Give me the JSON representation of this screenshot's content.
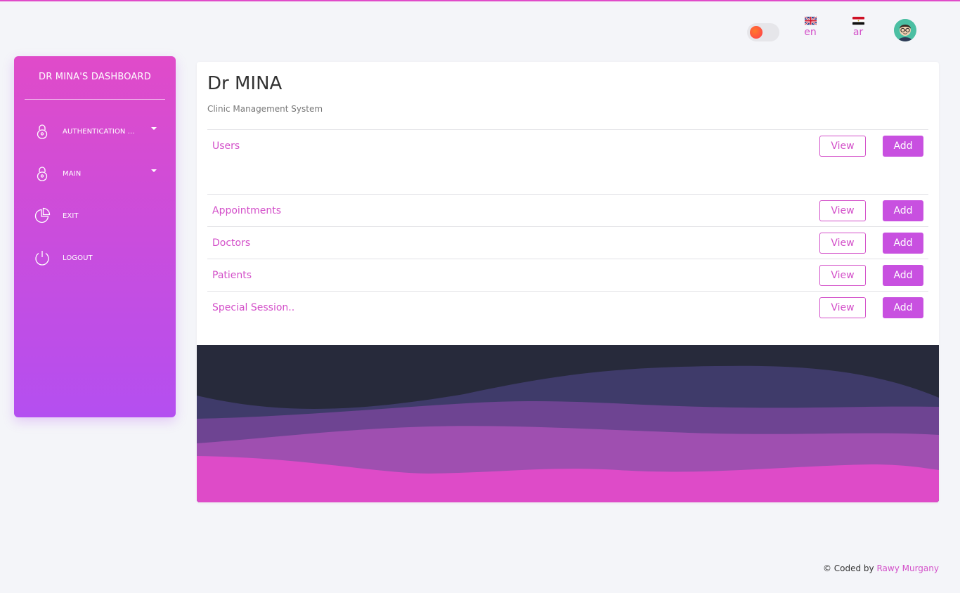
{
  "header": {
    "languages": [
      {
        "code": "en",
        "flag_icon": "uk-flag-icon"
      },
      {
        "code": "ar",
        "flag_icon": "egypt-flag-icon"
      }
    ],
    "theme_toggle_icon": "theme-toggle-icon",
    "avatar_icon": "user-avatar-icon"
  },
  "sidebar": {
    "title": "DR MINA'S DASHBOARD",
    "items": [
      {
        "label": "AUTHENTICATION ...",
        "icon": "lock-icon",
        "has_dropdown": true
      },
      {
        "label": "MAIN",
        "icon": "lock-icon",
        "has_dropdown": true
      },
      {
        "label": "EXIT",
        "icon": "pie-chart-icon",
        "has_dropdown": false
      },
      {
        "label": "LOGOUT",
        "icon": "power-icon",
        "has_dropdown": false
      }
    ]
  },
  "main": {
    "title": "Dr MINA",
    "subtitle": "Clinic Management System",
    "view_label": "View",
    "add_label": "Add",
    "rows": [
      {
        "label": "Users"
      },
      {
        "label": "Appointments"
      },
      {
        "label": "Doctors"
      },
      {
        "label": "Patients"
      },
      {
        "label": "Special Session.."
      }
    ]
  },
  "colors": {
    "accent": "#d34fc9",
    "sidebar_top": "#e04bc9",
    "sidebar_bottom": "#b44ff0",
    "button_add": "#c850e0",
    "wave_dark": "#272a3b"
  },
  "footer": {
    "prefix": "© Coded by",
    "author": "Rawy Murgany"
  }
}
